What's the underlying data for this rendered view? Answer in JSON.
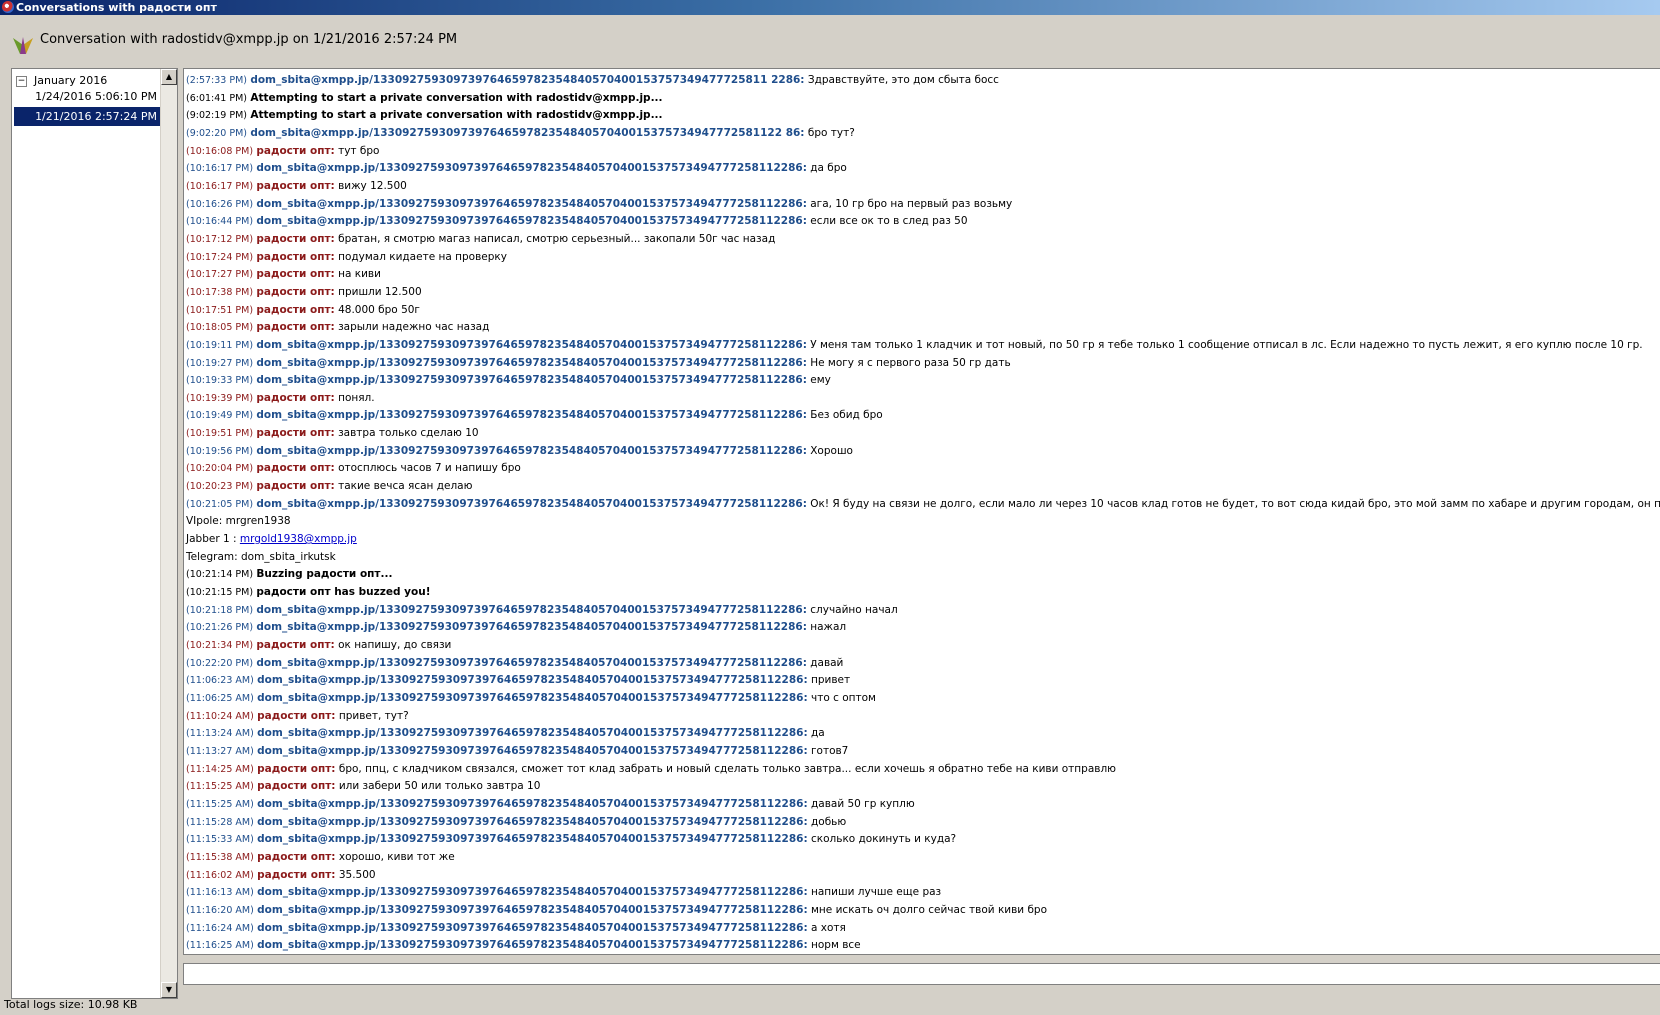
{
  "window": {
    "title": "Conversations with радости опт"
  },
  "header": {
    "title": "Conversation with radostidv@xmpp.jp on 1/21/2016 2:57:24 PM"
  },
  "tree": {
    "root": {
      "expander": "−",
      "label": "January 2016"
    },
    "children": [
      {
        "label": "1/24/2016 5:06:10 PM",
        "selected": false
      },
      {
        "label": "1/21/2016 2:57:24 PM",
        "selected": true
      }
    ]
  },
  "scroll": {
    "up": "▲",
    "down": "▼"
  },
  "status": {
    "text": "Total logs size: 10.98 KB"
  },
  "log": [
    {
      "type": "in",
      "time": "(2:57:33 PM)",
      "nick": "dom_sbita@xmpp.jp/133092759309739764659782354840570400153757349477725811 2286:",
      "msg": " Здравствуйте, это дом сбыта босс"
    },
    {
      "type": "sys",
      "time": "(6:01:41 PM)",
      "msg": " Attempting to start a private conversation with radostidv@xmpp.jp..."
    },
    {
      "type": "sys",
      "time": "(9:02:19 PM)",
      "msg": " Attempting to start a private conversation with radostidv@xmpp.jp..."
    },
    {
      "type": "in",
      "time": "(9:02:20 PM)",
      "nick": "dom_sbita@xmpp.jp/13309275930973976465978235484057040015375734947772581122 86:",
      "msg": " бро тут?"
    },
    {
      "type": "out",
      "time": "(10:16:08 PM)",
      "nick": "радости опт:",
      "msg": " тут бро"
    },
    {
      "type": "in",
      "time": "(10:16:17 PM)",
      "nick": "dom_sbita@xmpp.jp/1330927593097397646597823548405704001537573494777258112286:",
      "msg": " да бро"
    },
    {
      "type": "out",
      "time": "(10:16:17 PM)",
      "nick": "радости опт:",
      "msg": " вижу 12.500"
    },
    {
      "type": "in",
      "time": "(10:16:26 PM)",
      "nick": "dom_sbita@xmpp.jp/1330927593097397646597823548405704001537573494777258112286:",
      "msg": " ага, 10 гр бро на первый раз возьму"
    },
    {
      "type": "in",
      "time": "(10:16:44 PM)",
      "nick": "dom_sbita@xmpp.jp/1330927593097397646597823548405704001537573494777258112286:",
      "msg": " если все ок то в след раз 50"
    },
    {
      "type": "out",
      "time": "(10:17:12 PM)",
      "nick": "радости опт:",
      "msg": " братан, я смотрю магаз написал, смотрю серьезный... закопали 50г час назад"
    },
    {
      "type": "out",
      "time": "(10:17:24 PM)",
      "nick": "радости опт:",
      "msg": " подумал кидаете на проверку"
    },
    {
      "type": "out",
      "time": "(10:17:27 PM)",
      "nick": "радости опт:",
      "msg": " на киви"
    },
    {
      "type": "out",
      "time": "(10:17:38 PM)",
      "nick": "радости опт:",
      "msg": " пришли 12.500"
    },
    {
      "type": "out",
      "time": "(10:17:51 PM)",
      "nick": "радости опт:",
      "msg": " 48.000 бро 50г"
    },
    {
      "type": "out",
      "time": "(10:18:05 PM)",
      "nick": "радости опт:",
      "msg": " зарыли надежно час назад"
    },
    {
      "type": "in",
      "time": "(10:19:11 PM)",
      "nick": "dom_sbita@xmpp.jp/1330927593097397646597823548405704001537573494777258112286:",
      "msg": " У меня там только 1 кладчик и тот новый, по 50 гр я тебе только 1 сообщение отписал в лс. Если надежно то пусть лежит, я его куплю после 10 гр."
    },
    {
      "type": "in",
      "time": "(10:19:27 PM)",
      "nick": "dom_sbita@xmpp.jp/1330927593097397646597823548405704001537573494777258112286:",
      "msg": " Не могу я с первого раза 50 гр дать"
    },
    {
      "type": "in",
      "time": "(10:19:33 PM)",
      "nick": "dom_sbita@xmpp.jp/1330927593097397646597823548405704001537573494777258112286:",
      "msg": " ему"
    },
    {
      "type": "out",
      "time": "(10:19:39 PM)",
      "nick": "радости опт:",
      "msg": " понял."
    },
    {
      "type": "in",
      "time": "(10:19:49 PM)",
      "nick": "dom_sbita@xmpp.jp/1330927593097397646597823548405704001537573494777258112286:",
      "msg": " Без обид бро"
    },
    {
      "type": "out",
      "time": "(10:19:51 PM)",
      "nick": "радости опт:",
      "msg": " завтра только сделаю 10"
    },
    {
      "type": "in",
      "time": "(10:19:56 PM)",
      "nick": "dom_sbita@xmpp.jp/1330927593097397646597823548405704001537573494777258112286:",
      "msg": " Хорошо"
    },
    {
      "type": "out",
      "time": "(10:20:04 PM)",
      "nick": "радости опт:",
      "msg": " отосплюсь часов 7 и напишу бро"
    },
    {
      "type": "out",
      "time": "(10:20:23 PM)",
      "nick": "радости опт:",
      "msg": " такие вечса ясан делаю"
    },
    {
      "type": "in",
      "time": "(10:21:05 PM)",
      "nick": "dom_sbita@xmpp.jp/1330927593097397646597823548405704001537573494777258112286:",
      "msg": " Ок! Я буду на связи не долго, если мало ли через 10 часов клад готов не будет, то вот сюда кидай бро, это мой замм по хабаре и другим городам, он примет вес."
    },
    {
      "type": "plain",
      "time": "",
      "msg": "VIpole: mrgren1938"
    },
    {
      "type": "plain",
      "time": "",
      "msg": "Jabber 1 : ",
      "link": "mrgold1938@xmpp.jp"
    },
    {
      "type": "plain",
      "time": "",
      "msg": "Telegram: dom_sbita_irkutsk"
    },
    {
      "type": "sys",
      "time": "(10:21:14 PM)",
      "msg": " Buzzing радости опт..."
    },
    {
      "type": "sys",
      "time": "(10:21:15 PM)",
      "msg": " радости опт has buzzed you!"
    },
    {
      "type": "in",
      "time": "(10:21:18 PM)",
      "nick": "dom_sbita@xmpp.jp/1330927593097397646597823548405704001537573494777258112286:",
      "msg": " случайно начал"
    },
    {
      "type": "in",
      "time": "(10:21:26 PM)",
      "nick": "dom_sbita@xmpp.jp/1330927593097397646597823548405704001537573494777258112286:",
      "msg": " нажал"
    },
    {
      "type": "out",
      "time": "(10:21:34 PM)",
      "nick": "радости опт:",
      "msg": " ок напишу, до связи"
    },
    {
      "type": "in",
      "time": "(10:22:20 PM)",
      "nick": "dom_sbita@xmpp.jp/1330927593097397646597823548405704001537573494777258112286:",
      "msg": " давай"
    },
    {
      "type": "in",
      "time": "(11:06:23 AM)",
      "nick": "dom_sbita@xmpp.jp/1330927593097397646597823548405704001537573494777258112286:",
      "msg": " привет"
    },
    {
      "type": "in",
      "time": "(11:06:25 AM)",
      "nick": "dom_sbita@xmpp.jp/1330927593097397646597823548405704001537573494777258112286:",
      "msg": " что с оптом"
    },
    {
      "type": "out",
      "time": "(11:10:24 AM)",
      "nick": "радости опт:",
      "msg": " привет, тут?"
    },
    {
      "type": "in",
      "time": "(11:13:24 AM)",
      "nick": "dom_sbita@xmpp.jp/1330927593097397646597823548405704001537573494777258112286:",
      "msg": " да"
    },
    {
      "type": "in",
      "time": "(11:13:27 AM)",
      "nick": "dom_sbita@xmpp.jp/1330927593097397646597823548405704001537573494777258112286:",
      "msg": " готов7"
    },
    {
      "type": "out",
      "time": "(11:14:25 AM)",
      "nick": "радости опт:",
      "msg": " бро, ппц, с кладчиком связался, сможет тот клад забрать и новый сделать только завтра... если хочешь я обратно тебе на киви отправлю"
    },
    {
      "type": "out",
      "time": "(11:15:25 AM)",
      "nick": "радости опт:",
      "msg": " или забери 50 или только завтра 10"
    },
    {
      "type": "in",
      "time": "(11:15:25 AM)",
      "nick": "dom_sbita@xmpp.jp/1330927593097397646597823548405704001537573494777258112286:",
      "msg": " давай 50 гр куплю"
    },
    {
      "type": "in",
      "time": "(11:15:28 AM)",
      "nick": "dom_sbita@xmpp.jp/1330927593097397646597823548405704001537573494777258112286:",
      "msg": " добью"
    },
    {
      "type": "in",
      "time": "(11:15:33 AM)",
      "nick": "dom_sbita@xmpp.jp/1330927593097397646597823548405704001537573494777258112286:",
      "msg": " сколько докинуть и куда?"
    },
    {
      "type": "out",
      "time": "(11:15:38 AM)",
      "nick": "радости опт:",
      "msg": " хорошо, киви тот же"
    },
    {
      "type": "out",
      "time": "(11:16:02 AM)",
      "nick": "радости опт:",
      "msg": " 35.500"
    },
    {
      "type": "in",
      "time": "(11:16:13 AM)",
      "nick": "dom_sbita@xmpp.jp/1330927593097397646597823548405704001537573494777258112286:",
      "msg": " напиши лучше еще раз"
    },
    {
      "type": "in",
      "time": "(11:16:20 AM)",
      "nick": "dom_sbita@xmpp.jp/1330927593097397646597823548405704001537573494777258112286:",
      "msg": " мне искать оч долго сейчас твой киви бро"
    },
    {
      "type": "in",
      "time": "(11:16:24 AM)",
      "nick": "dom_sbita@xmpp.jp/1330927593097397646597823548405704001537573494777258112286:",
      "msg": " а хотя"
    },
    {
      "type": "in",
      "time": "(11:16:25 AM)",
      "nick": "dom_sbita@xmpp.jp/1330927593097397646597823548405704001537573494777258112286:",
      "msg": " норм все"
    }
  ]
}
